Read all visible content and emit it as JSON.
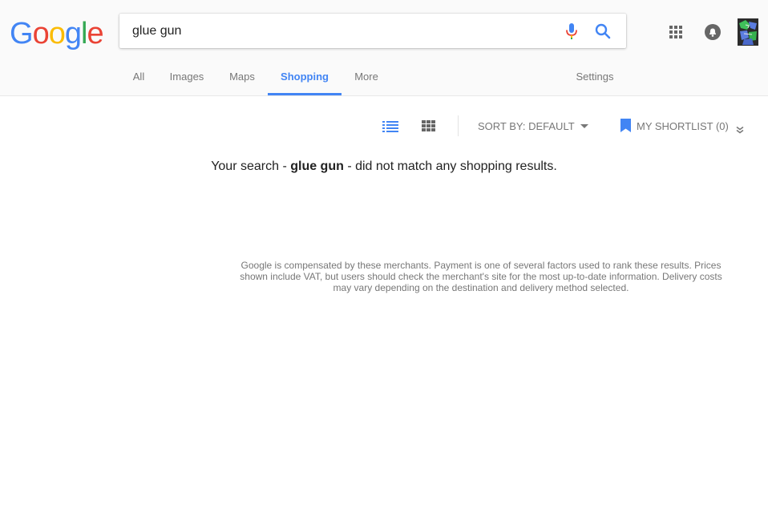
{
  "logo": {
    "letters": [
      "G",
      "o",
      "o",
      "g",
      "l",
      "e"
    ]
  },
  "search": {
    "query": "glue gun"
  },
  "icons": {
    "mic": "microphone-icon",
    "search": "search-icon",
    "apps": "apps-grid-icon",
    "notifications": "notifications-icon",
    "avatar": "account-avatar"
  },
  "nav": {
    "tabs": [
      {
        "label": "All"
      },
      {
        "label": "Images"
      },
      {
        "label": "Maps"
      },
      {
        "label": "Shopping",
        "active": true
      },
      {
        "label": "More"
      }
    ],
    "settings_label": "Settings"
  },
  "toolbar": {
    "sort_label": "SORT BY: DEFAULT",
    "shortlist_label": "MY SHORTLIST (0)"
  },
  "results": {
    "prefix": "Your search - ",
    "query": "glue gun",
    "suffix": " - did not match any shopping results."
  },
  "disclaimer": "Google is compensated by these merchants. Payment is one of several factors used to rank these results. Prices shown include VAT, but users should check the merchant's site for the most up-to-date information. Delivery costs may vary depending on the destination and delivery method selected.",
  "colors": {
    "blue": "#4285f4",
    "red": "#ea4335",
    "yellow": "#fbbc05",
    "green": "#34a853",
    "muted": "#777777"
  }
}
